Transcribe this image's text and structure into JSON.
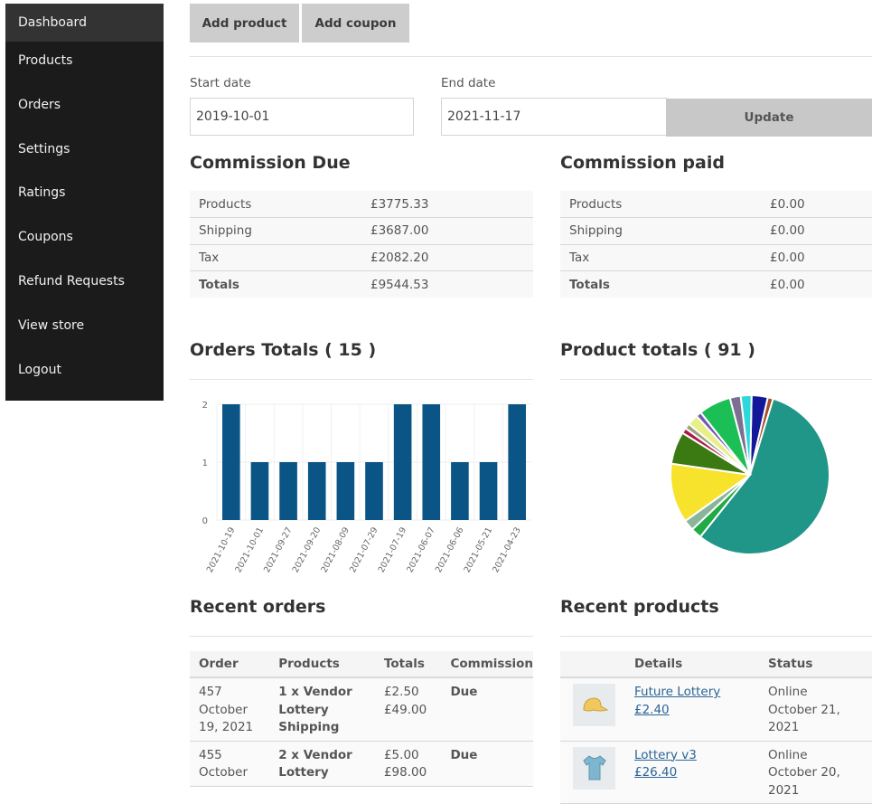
{
  "sidebar": {
    "items": [
      {
        "label": "Dashboard",
        "active": true
      },
      {
        "label": "Products"
      },
      {
        "label": "Orders"
      },
      {
        "label": "Settings"
      },
      {
        "label": "Ratings"
      },
      {
        "label": "Coupons"
      },
      {
        "label": "Refund Requests"
      },
      {
        "label": "View store"
      },
      {
        "label": "Logout"
      }
    ]
  },
  "toolbar": {
    "add_product_label": "Add product",
    "add_coupon_label": "Add coupon"
  },
  "filters": {
    "start_date_label": "Start date",
    "start_date_value": "2019-10-01",
    "end_date_label": "End date",
    "end_date_value": "2021-11-17",
    "update_label": "Update"
  },
  "commission_due": {
    "title": "Commission Due",
    "rows": [
      {
        "label": "Products",
        "value": "£3775.33"
      },
      {
        "label": "Shipping",
        "value": "£3687.00"
      },
      {
        "label": "Tax",
        "value": "£2082.20"
      },
      {
        "label": "Totals",
        "value": "£9544.53"
      }
    ]
  },
  "commission_paid": {
    "title": "Commission paid",
    "rows": [
      {
        "label": "Products",
        "value": "£0.00"
      },
      {
        "label": "Shipping",
        "value": "£0.00"
      },
      {
        "label": "Tax",
        "value": "£0.00"
      },
      {
        "label": "Totals",
        "value": "£0.00"
      }
    ]
  },
  "orders_totals": {
    "title": "Orders Totals ( 15 )"
  },
  "product_totals": {
    "title": "Product totals ( 91 )"
  },
  "chart_data": [
    {
      "type": "bar",
      "title": "Orders Totals ( 15 )",
      "categories": [
        "2021-10-19",
        "2021-10-01",
        "2021-09-27",
        "2021-09-20",
        "2021-08-09",
        "2021-07-29",
        "2021-07-19",
        "2021-06-07",
        "2021-06-06",
        "2021-05-21",
        "2021-04-23"
      ],
      "values": [
        2,
        1,
        1,
        1,
        1,
        1,
        2,
        2,
        1,
        1,
        2
      ],
      "ylim": [
        0,
        2
      ],
      "yticks": [
        "0",
        "1",
        "2"
      ],
      "xlabel": "",
      "ylabel": "",
      "grid": true,
      "color": "#0b5486"
    },
    {
      "type": "pie",
      "title": "Product totals ( 91 )",
      "values": [
        3,
        1,
        51,
        2,
        2,
        11,
        6,
        1,
        1,
        2,
        1,
        6,
        2,
        2
      ],
      "colors": [
        "#13179a",
        "#a4502b",
        "#1f9688",
        "#22aa46",
        "#8bb59b",
        "#f7e22c",
        "#3b7a12",
        "#b0174a",
        "#9aa37e",
        "#e8ef86",
        "#7657b4",
        "#1cbf56",
        "#7c6f92",
        "#2dd8dd"
      ]
    }
  ],
  "recent_orders": {
    "title": "Recent orders",
    "columns": [
      "Order",
      "Products",
      "Totals",
      "Commission"
    ],
    "rows": [
      {
        "order": "457",
        "date1": "October",
        "date2": "19, 2021",
        "products": [
          "1 x Vendor",
          "Lottery",
          "Shipping"
        ],
        "totals": [
          "£2.50",
          "£49.00"
        ],
        "commission": "Due"
      },
      {
        "order": "455",
        "date1": "October",
        "date2": "",
        "products": [
          "2 x Vendor",
          "Lottery",
          ""
        ],
        "totals": [
          "£5.00",
          "£98.00"
        ],
        "commission": "Due"
      }
    ]
  },
  "recent_products": {
    "title": "Recent products",
    "columns": [
      "",
      "Details",
      "Status"
    ],
    "rows": [
      {
        "name": "Future Lottery",
        "price": "£2.40",
        "status": "Online",
        "date": "October 21, 2021",
        "icon": "cap-icon"
      },
      {
        "name": "Lottery v3",
        "price": "£26.40",
        "status": "Online",
        "date": "October 20, 2021",
        "icon": "tshirt-icon"
      }
    ]
  }
}
